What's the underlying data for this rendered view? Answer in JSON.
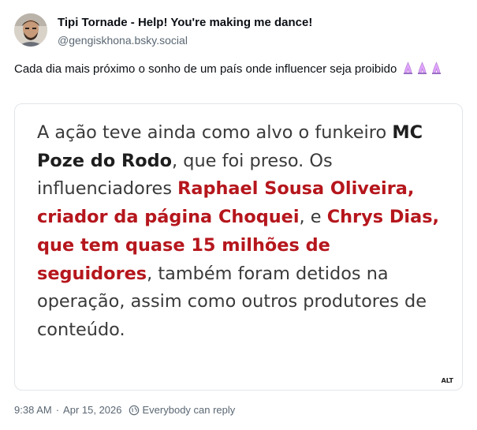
{
  "author": {
    "display_name": "Tipi Tornade - Help! You're making me dance!",
    "handle": "@gengiskhona.bsky.social",
    "avatar_icon": "user-avatar"
  },
  "post": {
    "text": "Cada dia mais próximo o sonho de um país onde influencer seja proibido",
    "emojis": [
      "🙏🏻",
      "🙏🏻",
      "🙏🏻"
    ]
  },
  "image": {
    "alt_badge": "ALT",
    "quote": {
      "p1": "A ação teve ainda como alvo o funkeiro ",
      "b1": "MC Poze do Rodo",
      "p2": ", que foi preso. Os influenciadores ",
      "r1": "Raphael Sousa Oliveira, criador da página Choquei",
      "p3": ", e ",
      "r2": "Chrys Dias, que tem quase 15 milhões de seguidores",
      "p4": ", também foram detidos na operação, assim como outros produtores de conteúdo."
    }
  },
  "footer": {
    "time": "9:38 AM",
    "separator": "·",
    "date": "Apr 15, 2026",
    "reply_setting": "Everybody can reply",
    "reply_icon": "globe-icon"
  },
  "colors": {
    "text": "#0b0f14",
    "muted": "#5a6773",
    "quote_red": "#b5161c",
    "border": "#e2e6ea"
  }
}
